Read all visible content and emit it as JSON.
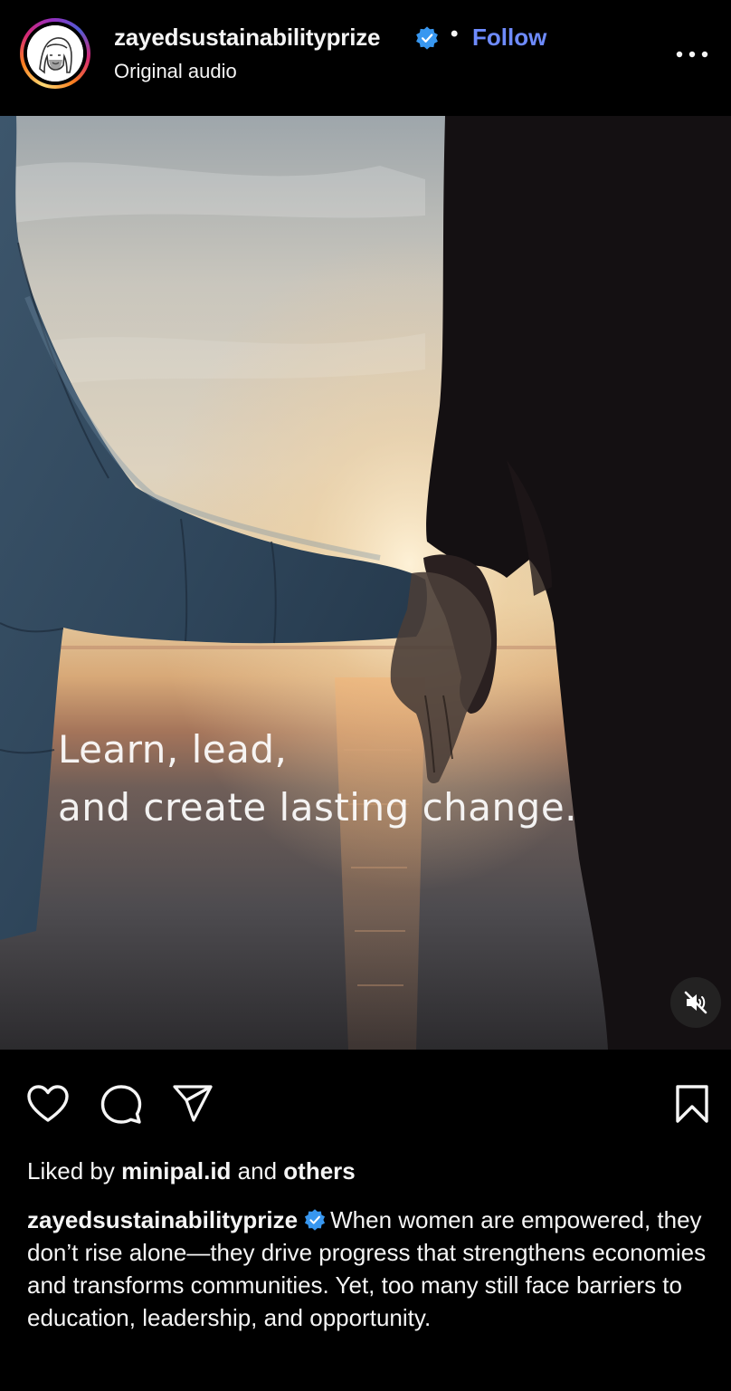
{
  "header": {
    "username": "zayedsustainabilityprize",
    "separator": "•",
    "follow_label": "Follow",
    "audio_label": "Original audio",
    "avatar_icon": "portrait-logo-icon",
    "more_icon": "more-horizontal-icon"
  },
  "media": {
    "overlay_line_1": "Learn, lead,",
    "overlay_line_2": "and create lasting change.",
    "mute_icon": "speaker-muted-icon"
  },
  "actions": {
    "like_icon": "heart-icon",
    "comment_icon": "comment-icon",
    "share_icon": "paper-plane-icon",
    "save_icon": "bookmark-icon"
  },
  "likes": {
    "prefix": "Liked by",
    "user": "minipal.id",
    "joiner": "and",
    "others": "others"
  },
  "caption": {
    "username": "zayedsustainabilityprize",
    "text": "When women are empowered, they don’t rise alone—they drive progress that strengthens economies and transforms communities. Yet, too many still face barriers to education, leadership, and opportunity."
  },
  "colors": {
    "background": "#000000",
    "text": "#f5f5f5",
    "follow_accent": "#6e8bff",
    "verified_badge": "#3897f0"
  }
}
